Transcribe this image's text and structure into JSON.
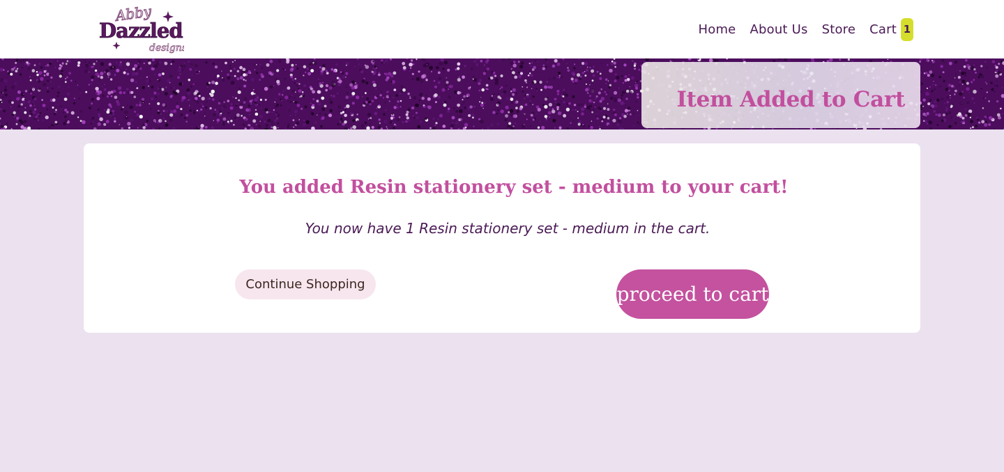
{
  "brand": {
    "logo_lines": [
      "Abby",
      "Dazzled",
      "designs"
    ],
    "colors": {
      "primary": "#4a1a55",
      "accent": "#c24f9e",
      "badge": "#d6de2d",
      "page_bg": "#ebe1ef"
    }
  },
  "nav": {
    "items": [
      {
        "label": "Home"
      },
      {
        "label": "About Us"
      },
      {
        "label": "Store"
      }
    ],
    "cart_label": "Cart",
    "cart_count": "1"
  },
  "banner": {
    "title": "Item Added to Cart"
  },
  "confirmation": {
    "title": "You added Resin stationery set - medium to your cart!",
    "subtitle": "You now have 1 Resin stationery set - medium in the cart.",
    "continue_label": "Continue Shopping",
    "proceed_label": "proceed to cart"
  }
}
